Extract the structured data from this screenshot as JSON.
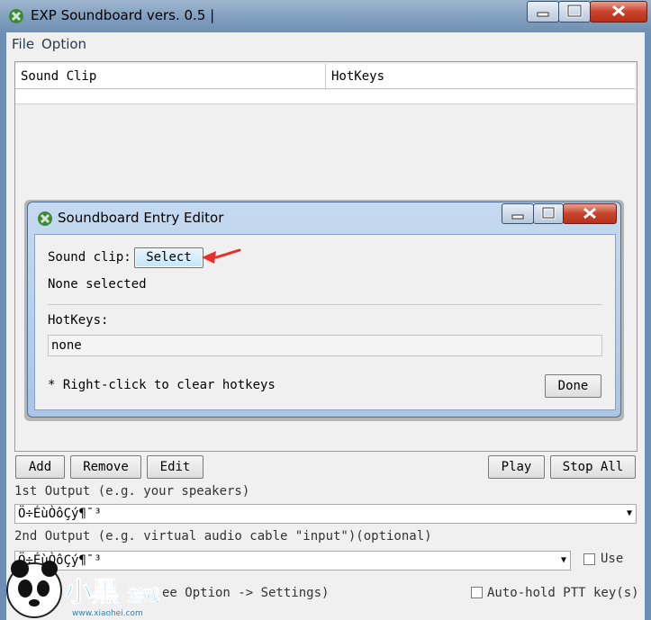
{
  "window": {
    "title": "EXP Soundboard vers. 0.5 |",
    "menu": [
      "File",
      "Option"
    ]
  },
  "table": {
    "columns": [
      "Sound Clip",
      "HotKeys"
    ],
    "rows": []
  },
  "buttons": {
    "add": "Add",
    "remove": "Remove",
    "edit": "Edit",
    "play": "Play",
    "stop_all": "Stop All"
  },
  "outputs": {
    "first_label": "1st Output (e.g. your speakers)",
    "first_value": "Ö÷ÉùÒôÇý¶¯³",
    "second_label": "2nd Output (e.g. virtual audio cable \"input\")(optional)",
    "second_value": "Ö÷ÉùÒôÇý¶¯³",
    "use_label": "Use",
    "settings_hint": "ee Option -> Settings)",
    "auto_hold_label": "Auto-hold PTT key(s)"
  },
  "dialog": {
    "title": "Soundboard Entry Editor",
    "sound_clip_label": "Sound clip:",
    "select_button": "Select",
    "none_selected": "None selected",
    "hotkeys_label": "HotKeys:",
    "hotkeys_value": "none",
    "hint": "* Right-click to clear hotkeys",
    "done_button": "Done"
  },
  "watermark": {
    "brand": "小黑游戏",
    "url": "www.xiaohei.com"
  },
  "colors": {
    "titlebar": "#7e9cbd",
    "select_button": "#bee6fd",
    "arrow": "#e8302a",
    "close_button": "#c8432b"
  }
}
